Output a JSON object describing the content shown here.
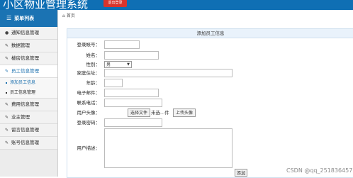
{
  "header": {
    "app_title": "小区物业管理系统",
    "logout_label": "退出登录",
    "bg_color": "#0f6fb4",
    "logout_color": "#d9342b"
  },
  "sidebar": {
    "title": "菜单列表",
    "items": [
      {
        "label": "通知信息管理",
        "icon": "bell-icon"
      },
      {
        "label": "数据管理",
        "icon": "edit-icon"
      },
      {
        "label": "楼房信息管理",
        "icon": "edit-icon"
      },
      {
        "label": "员工信息管理",
        "icon": "edit-icon",
        "open": true
      },
      {
        "label": "费用信息管理",
        "icon": "edit-icon"
      },
      {
        "label": "业主管理",
        "icon": "edit-icon"
      },
      {
        "label": "留言信息管理",
        "icon": "edit-icon"
      },
      {
        "label": "账号信息管理",
        "icon": "edit-icon"
      }
    ],
    "subitems": [
      {
        "label": "添加员工信息",
        "active": true
      },
      {
        "label": "员工信息管理",
        "active": false
      }
    ]
  },
  "breadcrumb": {
    "icon": "home-icon",
    "label": "首页"
  },
  "form": {
    "title": "添加员工信息",
    "fields": {
      "login_account": {
        "label": "登录帐号：",
        "value": ""
      },
      "name": {
        "label": "姓名：",
        "value": ""
      },
      "gender": {
        "label": "性别：",
        "value": "男"
      },
      "address": {
        "label": "家庭住址：",
        "value": ""
      },
      "age": {
        "label": "年龄：",
        "value": ""
      },
      "email": {
        "label": "电子邮件：",
        "value": ""
      },
      "phone": {
        "label": "联系电话：",
        "value": ""
      },
      "avatar": {
        "label": "用户头像：",
        "choose_label": "选择文件",
        "no_file_text": "未选...件",
        "upload_label": "上传头像"
      },
      "password": {
        "label": "登录密码：",
        "value": ""
      },
      "description": {
        "label": "用户描述：",
        "value": ""
      }
    },
    "submit_label": "添加"
  },
  "watermark": "CSDN @qq_251836457"
}
